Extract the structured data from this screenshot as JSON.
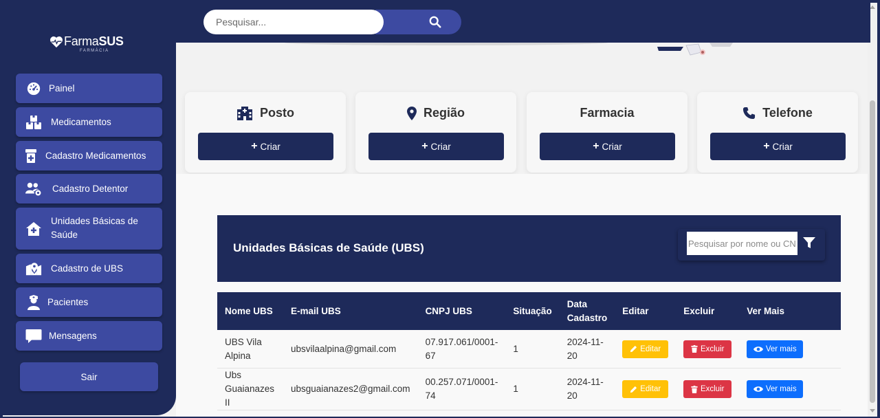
{
  "brand": {
    "name_light": "Farma",
    "name_bold": "SUS",
    "subtitle": "FARMÁCIA"
  },
  "sidebar": {
    "items": [
      {
        "label": "Painel",
        "icon": "gauge-icon"
      },
      {
        "label": "Medicamentos",
        "icon": "boxes-icon"
      },
      {
        "label": "Cadastro Medicamentos",
        "icon": "prescription-bottle-icon"
      },
      {
        "label": "Cadastro Detentor",
        "icon": "users-gear-icon"
      },
      {
        "label": "Unidades Básicas de Saúde",
        "icon": "house-medical-icon"
      },
      {
        "label": "Cadastro de UBS",
        "icon": "map-location-icon"
      },
      {
        "label": "Pacientes",
        "icon": "user-nurse-icon"
      },
      {
        "label": "Mensagens",
        "icon": "message-icon"
      }
    ],
    "logout_label": "Sair"
  },
  "topbar": {
    "search_placeholder": "Pesquisar..."
  },
  "cards": [
    {
      "title": "Posto",
      "icon": "hospital-building-icon",
      "button_label": "Criar"
    },
    {
      "title": "Região",
      "icon": "location-pin-icon",
      "button_label": "Criar"
    },
    {
      "title": "Farmacia",
      "icon": "",
      "button_label": "Criar"
    },
    {
      "title": "Telefone",
      "icon": "phone-icon",
      "button_label": "Criar"
    }
  ],
  "ubs_section": {
    "title": "Unidades Básicas de Saúde (UBS)",
    "filter_placeholder": "Pesquisar por nome ou CNPJ",
    "columns": [
      "Nome UBS",
      "E-mail UBS",
      "CNPJ UBS",
      "Situação",
      "Data Cadastro",
      "Editar",
      "Excluir",
      "Ver Mais"
    ],
    "rows": [
      {
        "nome": "UBS Vila Alpina",
        "email": "ubsvilaalpina@gmail.com",
        "cnpj": "07.917.061/0001-67",
        "situacao": "1",
        "data": "2024-11-20"
      },
      {
        "nome": "Ubs Guaianazes II",
        "email": "ubsguaianazes2@gmail.com",
        "cnpj": "00.257.071/0001-74",
        "situacao": "1",
        "data": "2024-11-20"
      }
    ],
    "actions": {
      "edit_label": "Editar",
      "delete_label": "Excluir",
      "more_label": "Ver mais"
    }
  },
  "colors": {
    "navy": "#1e2a5a",
    "nav_button": "#3d4aa1",
    "edit": "#ffc107",
    "delete": "#dc3545",
    "more": "#0d6efd"
  }
}
